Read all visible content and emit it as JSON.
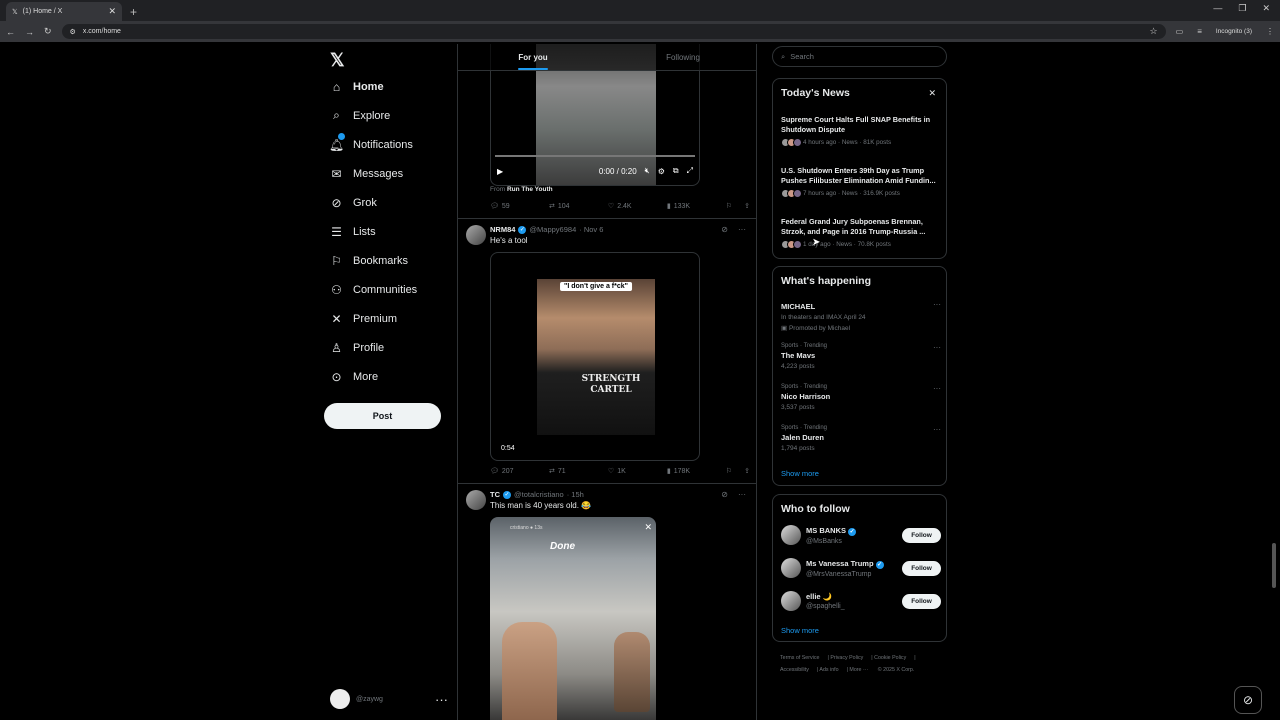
{
  "browser": {
    "tab_title": "(1) Home / X",
    "url": "x.com/home",
    "incognito_label": "Incognito (3)"
  },
  "nav": {
    "items": [
      {
        "label": "Home",
        "icon": "home-icon"
      },
      {
        "label": "Explore",
        "icon": "search-icon"
      },
      {
        "label": "Notifications",
        "icon": "bell-icon"
      },
      {
        "label": "Messages",
        "icon": "envelope-icon"
      },
      {
        "label": "Grok",
        "icon": "grok-icon"
      },
      {
        "label": "Lists",
        "icon": "list-icon"
      },
      {
        "label": "Bookmarks",
        "icon": "bookmark-icon"
      },
      {
        "label": "Communities",
        "icon": "people-icon"
      },
      {
        "label": "Premium",
        "icon": "x-icon"
      },
      {
        "label": "Profile",
        "icon": "person-icon"
      },
      {
        "label": "More",
        "icon": "more-circle-icon"
      }
    ],
    "post_label": "Post",
    "account_handle": "@zaywg"
  },
  "timeline": {
    "tabs": [
      "For you",
      "Following"
    ],
    "post1": {
      "video_time": "0:00 / 0:20",
      "from_prefix": "From",
      "from_source": "Run The Youth",
      "replies": "59",
      "reposts": "104",
      "likes": "2.4K",
      "views": "133K"
    },
    "post2": {
      "name": "NRM84",
      "handle": "@Mappy6984",
      "date": "· Nov 6",
      "text": "He's a tool",
      "caption": "\"I don't give a f*ck\"",
      "shirt": "STRENGTH CARTEL",
      "duration": "0:54",
      "replies": "207",
      "reposts": "71",
      "likes": "1K",
      "views": "178K"
    },
    "post3": {
      "name": "TC",
      "handle": "@totalcristiano",
      "date": "· 15h",
      "text": "This man is 40 years old. 😂",
      "overlay": "Done",
      "overlay_user": "cristiano ● 13s"
    }
  },
  "sidebar": {
    "search_placeholder": "Search",
    "news": {
      "title": "Today's News",
      "items": [
        {
          "title": "Supreme Court Halts Full SNAP Benefits in Shutdown Dispute",
          "meta": "4 hours ago · News · 81K posts"
        },
        {
          "title": "U.S. Shutdown Enters 39th Day as Trump Pushes Filibuster Elimination Amid Fundin...",
          "meta": "7 hours ago · News · 316.9K posts"
        },
        {
          "title": "Federal Grand Jury Subpoenas Brennan, Strzok, and Page in 2016 Trump-Russia ...",
          "meta": "1 day ago · News · 70.8K posts"
        }
      ]
    },
    "happening": {
      "title": "What's happening",
      "items": [
        {
          "category": "",
          "name": "MICHAEL",
          "sub": "In theaters and IMAX April 24",
          "promo": "Promoted by Michael"
        },
        {
          "category": "Sports · Trending",
          "name": "The Mavs",
          "sub": "4,223 posts"
        },
        {
          "category": "Sports · Trending",
          "name": "Nico Harrison",
          "sub": "3,537 posts"
        },
        {
          "category": "Sports · Trending",
          "name": "Jalen Duren",
          "sub": "1,794 posts"
        }
      ],
      "show_more": "Show more"
    },
    "follow": {
      "title": "Who to follow",
      "items": [
        {
          "name": "MS BANKS",
          "handle": "@MsBanks",
          "verified": true
        },
        {
          "name": "Ms Vanessa Trump",
          "handle": "@MrsVanessaTrump",
          "verified": true
        },
        {
          "name": "ellie 🌙",
          "handle": "@spaghelli_",
          "verified": false
        }
      ],
      "follow_label": "Follow",
      "show_more": "Show more"
    },
    "footer": [
      "Terms of Service",
      "Privacy Policy",
      "Cookie Policy",
      "Accessibility",
      "Ads info",
      "More ···",
      "© 2025 X Corp."
    ]
  },
  "colors": {
    "accent": "#1d9bf0",
    "background": "#000000",
    "border": "#2f3336",
    "muted": "#71767b"
  }
}
